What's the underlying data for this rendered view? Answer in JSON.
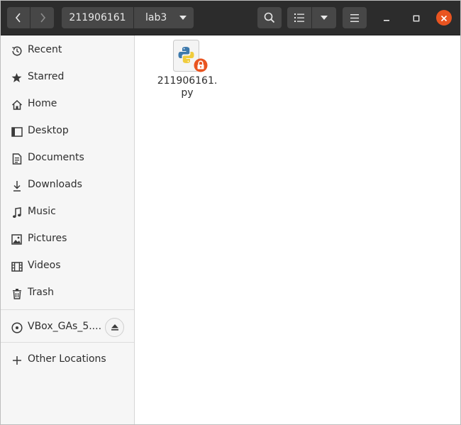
{
  "header": {
    "breadcrumb": [
      "211906161",
      "lab3"
    ]
  },
  "sidebar": {
    "items": [
      {
        "label": "Recent",
        "icon": "clock-icon"
      },
      {
        "label": "Starred",
        "icon": "star-icon"
      },
      {
        "label": "Home",
        "icon": "home-icon"
      },
      {
        "label": "Desktop",
        "icon": "desktop-icon"
      },
      {
        "label": "Documents",
        "icon": "document-icon"
      },
      {
        "label": "Downloads",
        "icon": "download-icon"
      },
      {
        "label": "Music",
        "icon": "music-icon"
      },
      {
        "label": "Pictures",
        "icon": "picture-icon"
      },
      {
        "label": "Videos",
        "icon": "video-icon"
      },
      {
        "label": "Trash",
        "icon": "trash-icon"
      }
    ],
    "devices": [
      {
        "label": "VBox_GAs_5....",
        "icon": "disc-icon"
      }
    ],
    "other": {
      "label": "Other Locations",
      "icon": "plus-icon"
    }
  },
  "files": [
    {
      "name": "211906161.py",
      "icon": "python-file-icon",
      "badge": "lock-icon"
    }
  ],
  "colors": {
    "headerbar": "#2c2c2c",
    "close": "#e95420",
    "lock_badge": "#e95420"
  }
}
